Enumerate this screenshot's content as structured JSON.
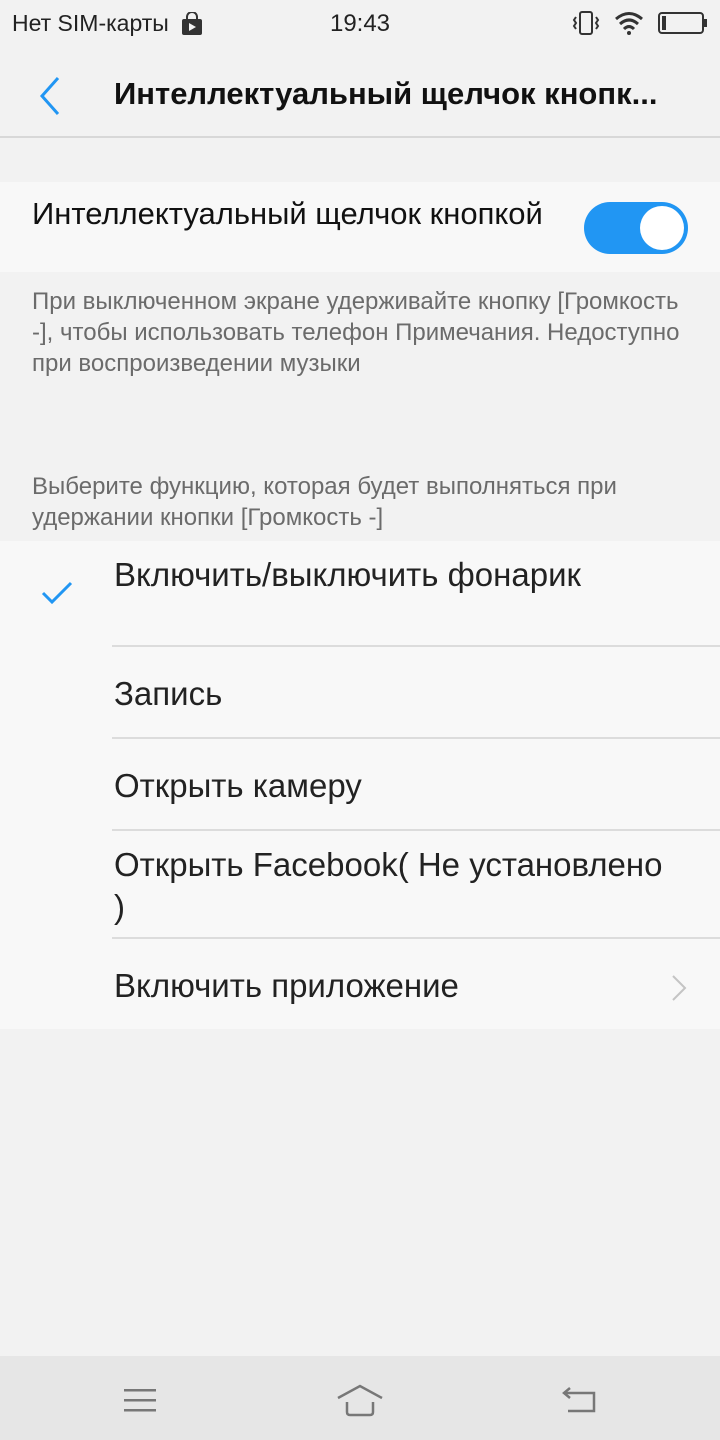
{
  "status_bar": {
    "carrier": "Нет SIM-карты",
    "time": "19:43",
    "icons": [
      "store-icon",
      "vibrate-icon",
      "wifi-icon",
      "battery-icon"
    ]
  },
  "header": {
    "title": "Интеллектуальный щелчок кнопк..."
  },
  "toggle": {
    "label": "Интеллектуальный щелчок кнопкой",
    "state": "on",
    "accent_color": "#2196f3"
  },
  "description": "При выключенном экране удерживайте кнопку [Громкость -], чтобы использовать телефон Примечания. Недоступно при воспроизведении музыки",
  "select_hint": "Выберите функцию, которая будет выполняться при удержании кнопки [Громкость -]",
  "options": [
    {
      "label": "Включить/выключить фонарик",
      "selected": true
    },
    {
      "label": "Запись",
      "selected": false
    },
    {
      "label": "Открыть камеру",
      "selected": false
    },
    {
      "label": "Открыть Facebook( Не установлено )",
      "selected": false
    },
    {
      "label": "Включить приложение",
      "selected": false,
      "has_chevron": true
    }
  ],
  "nav_bar": {
    "icons": [
      "menu-icon",
      "home-icon",
      "back-icon"
    ]
  }
}
